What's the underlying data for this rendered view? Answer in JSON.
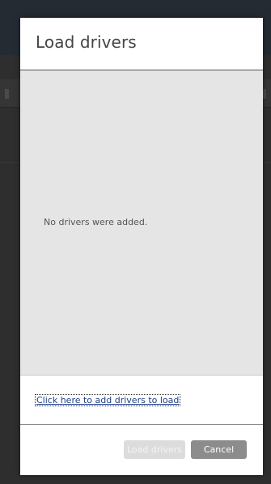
{
  "dialog": {
    "title": "Load drivers",
    "empty_message": "No drivers were added.",
    "add_link_label": "Click here to add drivers to load",
    "buttons": {
      "load_label": "Load drivers",
      "cancel_label": "Cancel"
    }
  },
  "colors": {
    "backdrop": "#2e2e2e",
    "dialog_bg": "#ffffff",
    "list_bg": "#e5e5e5",
    "link": "#1f3f87",
    "cancel_button": "#8c8c8c",
    "load_button_disabled": "#dcdcdc"
  }
}
